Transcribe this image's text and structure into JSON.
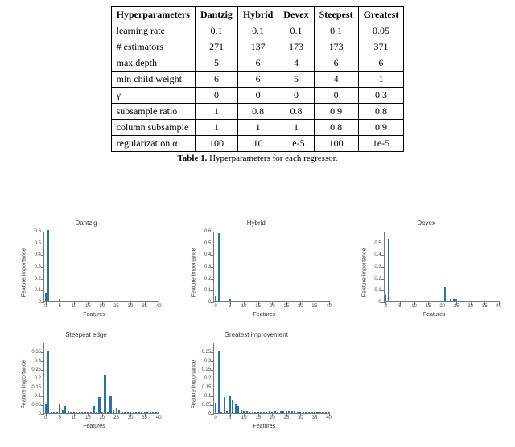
{
  "table": {
    "headers": [
      "Hyperparameters",
      "Dantzig",
      "Hybrid",
      "Devex",
      "Steepest",
      "Greatest"
    ],
    "rows": [
      [
        "learning rate",
        "0.1",
        "0.1",
        "0.1",
        "0.1",
        "0.05"
      ],
      [
        "# estimators",
        "271",
        "137",
        "173",
        "173",
        "371"
      ],
      [
        "max depth",
        "5",
        "6",
        "4",
        "6",
        "6"
      ],
      [
        "min child weight",
        "6",
        "6",
        "5",
        "4",
        "1"
      ],
      [
        "γ",
        "0",
        "0",
        "0",
        "0",
        "0.3"
      ],
      [
        "subsample ratio",
        "1",
        "0.8",
        "0.8",
        "0.9",
        "0.8"
      ],
      [
        "column subsample",
        "1",
        "1",
        "1",
        "0.8",
        "0.9"
      ],
      [
        "regularization α",
        "100",
        "10",
        "1e-5",
        "100",
        "1e-5"
      ]
    ],
    "caption_bold": "Table 1.",
    "caption_text": " Hyperparameters for each regressor."
  },
  "chart_data": [
    {
      "type": "bar",
      "title": "Dantzig",
      "xlabel": "Features",
      "ylabel": "Feature importance",
      "ylim": [
        0,
        0.6
      ],
      "yticks": [
        0.0,
        0.1,
        0.2,
        0.3,
        0.4,
        0.5,
        0.6
      ],
      "xticks": [
        0,
        5,
        10,
        15,
        20,
        25,
        30,
        35,
        40
      ],
      "categories": [
        0,
        1,
        2,
        3,
        4,
        5,
        6,
        7,
        8,
        9,
        10,
        11,
        12,
        13,
        14,
        15,
        16,
        17,
        18,
        19,
        20,
        21,
        22,
        23,
        24,
        25,
        26,
        27,
        28,
        29,
        30,
        31,
        32,
        33,
        34,
        35,
        36,
        37,
        38,
        39,
        40
      ],
      "values": [
        0.07,
        0.61,
        0,
        0.005,
        0.005,
        0.02,
        0.01,
        0.01,
        0.005,
        0.01,
        0.005,
        0.005,
        0.005,
        0.005,
        0.005,
        0.005,
        0.005,
        0.005,
        0.005,
        0.005,
        0.005,
        0.005,
        0.005,
        0.005,
        0.005,
        0.005,
        0.005,
        0.005,
        0.005,
        0.005,
        0.005,
        0.005,
        0.005,
        0.005,
        0.005,
        0.005,
        0.005,
        0.005,
        0.005,
        0.005,
        0.005
      ]
    },
    {
      "type": "bar",
      "title": "Hybrid",
      "xlabel": "Features",
      "ylabel": "Feature importance",
      "ylim": [
        0,
        0.6
      ],
      "yticks": [
        0.0,
        0.1,
        0.2,
        0.3,
        0.4,
        0.5,
        0.6
      ],
      "xticks": [
        0,
        5,
        10,
        15,
        20,
        25,
        30,
        35,
        40
      ],
      "categories": [
        0,
        1,
        2,
        3,
        4,
        5,
        6,
        7,
        8,
        9,
        10,
        11,
        12,
        13,
        14,
        15,
        16,
        17,
        18,
        19,
        20,
        21,
        22,
        23,
        24,
        25,
        26,
        27,
        28,
        29,
        30,
        31,
        32,
        33,
        34,
        35,
        36,
        37,
        38,
        39,
        40
      ],
      "values": [
        0.05,
        0.58,
        0,
        0.01,
        0.01,
        0.02,
        0.01,
        0.01,
        0.01,
        0.01,
        0.01,
        0.01,
        0.01,
        0.01,
        0.01,
        0.01,
        0.01,
        0.01,
        0.01,
        0.01,
        0.01,
        0.01,
        0.01,
        0.01,
        0.01,
        0.01,
        0.01,
        0.01,
        0.01,
        0.01,
        0.01,
        0.01,
        0.01,
        0.01,
        0.01,
        0.01,
        0.01,
        0.01,
        0.01,
        0.01,
        0.01
      ]
    },
    {
      "type": "bar",
      "title": "Devex",
      "xlabel": "Features",
      "ylabel": "Feature importance",
      "ylim": [
        0,
        0.6
      ],
      "yticks": [
        0.0,
        0.1,
        0.2,
        0.3,
        0.4,
        0.5
      ],
      "xticks": [
        0,
        5,
        10,
        15,
        20,
        25,
        30,
        35,
        40
      ],
      "categories": [
        0,
        1,
        2,
        3,
        4,
        5,
        6,
        7,
        8,
        9,
        10,
        11,
        12,
        13,
        14,
        15,
        16,
        17,
        18,
        19,
        20,
        21,
        22,
        23,
        24,
        25,
        26,
        27,
        28,
        29,
        30,
        31,
        32,
        33,
        34,
        35,
        36,
        37,
        38,
        39,
        40
      ],
      "values": [
        0.055,
        0.53,
        0,
        0.005,
        0.005,
        0.01,
        0.01,
        0.005,
        0.005,
        0.005,
        0.005,
        0.005,
        0.005,
        0.005,
        0.005,
        0.005,
        0.005,
        0.005,
        0.005,
        0.005,
        0.005,
        0.12,
        0.005,
        0.02,
        0.02,
        0.02,
        0.01,
        0.01,
        0.01,
        0.01,
        0.01,
        0.01,
        0.01,
        0.01,
        0.01,
        0.01,
        0.01,
        0.01,
        0.01,
        0.01,
        0.01
      ]
    },
    {
      "type": "bar",
      "title": "Steepest edge",
      "xlabel": "Features",
      "ylabel": "Feature importance",
      "ylim": [
        0,
        0.4
      ],
      "yticks": [
        0.0,
        0.05,
        0.1,
        0.15,
        0.2,
        0.25,
        0.3,
        0.35
      ],
      "xticks": [
        0,
        5,
        10,
        15,
        20,
        25,
        30,
        35,
        40
      ],
      "categories": [
        0,
        1,
        2,
        3,
        4,
        5,
        6,
        7,
        8,
        9,
        10,
        11,
        12,
        13,
        14,
        15,
        16,
        17,
        18,
        19,
        20,
        21,
        22,
        23,
        24,
        25,
        26,
        27,
        28,
        29,
        30,
        31,
        32,
        33,
        34,
        35,
        36,
        37,
        38,
        39,
        40
      ],
      "values": [
        0.05,
        0.35,
        0.005,
        0.01,
        0.01,
        0.05,
        0.02,
        0.04,
        0.015,
        0.01,
        0.01,
        0.005,
        0.005,
        0.005,
        0.005,
        0.005,
        0.005,
        0.04,
        0.005,
        0.09,
        0.005,
        0.22,
        0.01,
        0.1,
        0.02,
        0.03,
        0.02,
        0.01,
        0.01,
        0.01,
        0.01,
        0.01,
        0.005,
        0.005,
        0.005,
        0.005,
        0.005,
        0.005,
        0.005,
        0.005,
        0.01
      ]
    },
    {
      "type": "bar",
      "title": "Greatest improvement",
      "xlabel": "Features",
      "ylabel": "Feature importance",
      "ylim": [
        0,
        0.4
      ],
      "yticks": [
        0.0,
        0.05,
        0.1,
        0.15,
        0.2,
        0.25,
        0.3,
        0.35
      ],
      "xticks": [
        0,
        5,
        10,
        15,
        20,
        25,
        30,
        35,
        40
      ],
      "categories": [
        0,
        1,
        2,
        3,
        4,
        5,
        6,
        7,
        8,
        9,
        10,
        11,
        12,
        13,
        14,
        15,
        16,
        17,
        18,
        19,
        20,
        21,
        22,
        23,
        24,
        25,
        26,
        27,
        28,
        29,
        30,
        31,
        32,
        33,
        34,
        35,
        36,
        37,
        38,
        39,
        40
      ],
      "values": [
        0.06,
        0.35,
        0.005,
        0.09,
        0.015,
        0.1,
        0.075,
        0.055,
        0.04,
        0.02,
        0.015,
        0.015,
        0.01,
        0.01,
        0.01,
        0.01,
        0.01,
        0.01,
        0.01,
        0.015,
        0.01,
        0.015,
        0.01,
        0.015,
        0.015,
        0.015,
        0.015,
        0.015,
        0.015,
        0.01,
        0.01,
        0.01,
        0.01,
        0.01,
        0.01,
        0.01,
        0.01,
        0.01,
        0.01,
        0.01,
        0.01
      ]
    }
  ]
}
